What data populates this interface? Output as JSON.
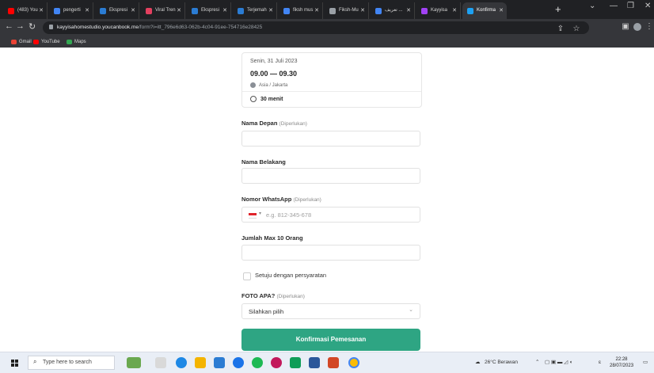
{
  "browser": {
    "tabs": [
      {
        "label": "(483) You",
        "color": "#ff0000"
      },
      {
        "label": "pengerti",
        "color": "#4285f4"
      },
      {
        "label": "Ekspresi",
        "color": "#2b7cd3"
      },
      {
        "label": "Viral Tren",
        "color": "#e4405f"
      },
      {
        "label": "Ekspresi",
        "color": "#2b7cd3"
      },
      {
        "label": "Terjemah",
        "color": "#2b7cd3"
      },
      {
        "label": "fiksh mus",
        "color": "#4285f4"
      },
      {
        "label": "Fiksh-Mu",
        "color": "#9aa0a6"
      },
      {
        "label": "تعريف ...",
        "color": "#4285f4"
      },
      {
        "label": "Kayyisa",
        "color": "#a142f4"
      },
      {
        "label": "Konfirma",
        "color": "#1da1f2"
      }
    ],
    "new_tab": "+",
    "url_host": "kayyisahomestudio.youcanbook.me",
    "url_path": "/form?i=itt_796e6d63-062b-4c04-91ee-754716e28425",
    "bookmarks": [
      {
        "label": "Gmail",
        "color": "#ea4335"
      },
      {
        "label": "YouTube",
        "color": "#ff0000"
      },
      {
        "label": "Maps",
        "color": "#34a853"
      }
    ]
  },
  "booking": {
    "date": "Senin, 31 Juli 2023",
    "time": "09.00 — 09.30",
    "timezone": "Asia / Jakarta",
    "duration": "30 menit"
  },
  "form": {
    "first_name_label": "Nama Depan",
    "required_text": "(Diperlukan)",
    "last_name_label": "Nama Belakang",
    "whatsapp_label": "Nomor WhatsApp",
    "whatsapp_placeholder": "e.g. 812-345-678",
    "max_people_label": "Jumlah Max 10 Orang",
    "agree_label": "Setuju dengan persyaratan",
    "photo_label": "FOTO APA?",
    "photo_select_value": "Silahkan pilih",
    "submit_label": "Konfirmasi Pemesanan"
  },
  "taskbar": {
    "search_placeholder": "Type here to search",
    "weather": "26°C Berawan",
    "lang": "ɛ",
    "time": "22:28",
    "date": "28/07/2023"
  }
}
